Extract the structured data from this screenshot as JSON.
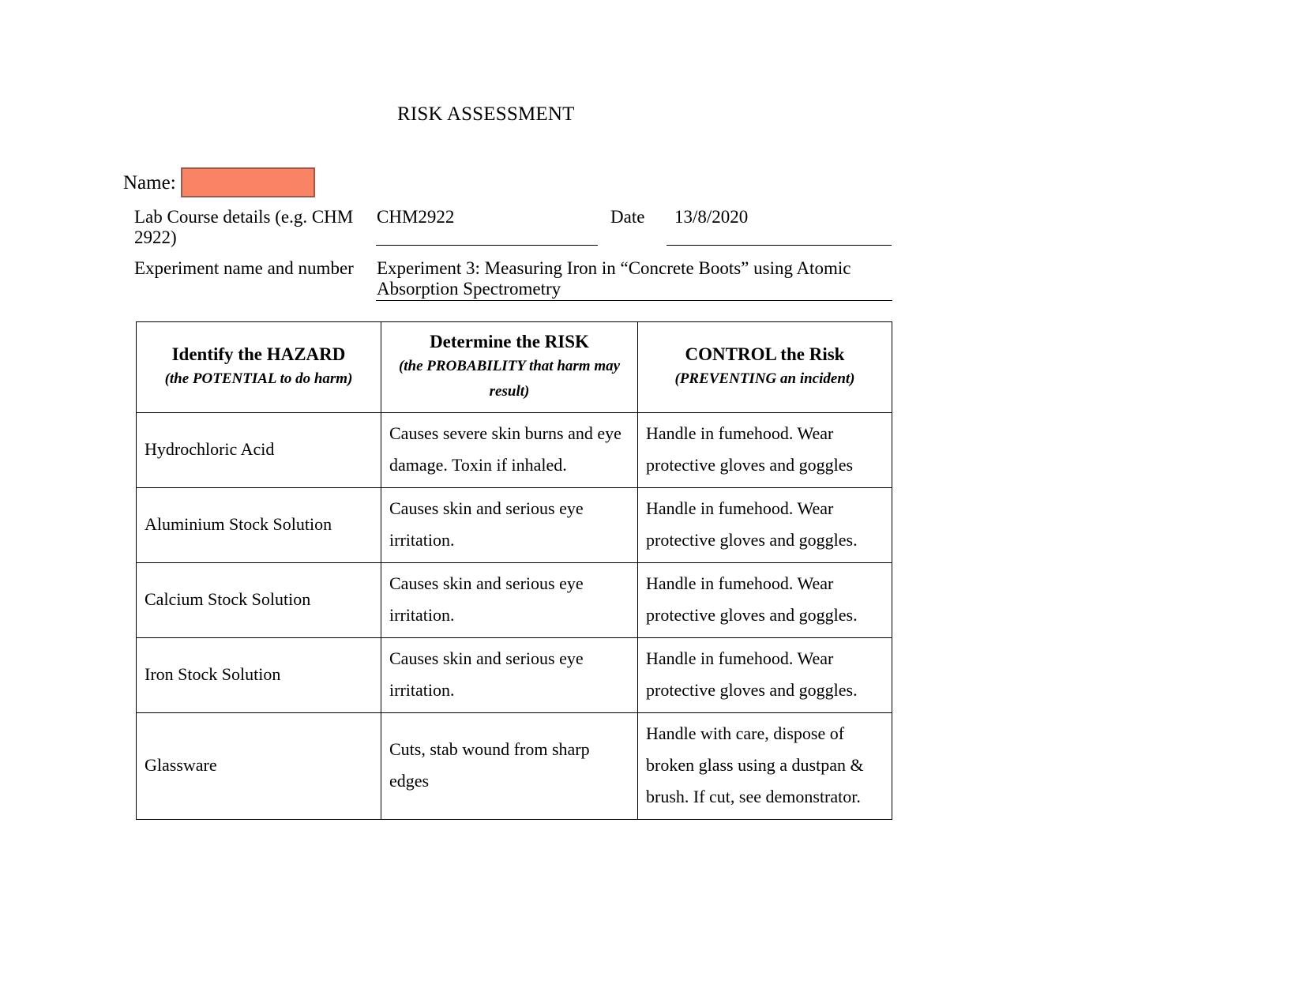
{
  "document": {
    "title": "RISK ASSESSMENT"
  },
  "name_field": {
    "label": "Name:",
    "value": "",
    "redacted": true,
    "redaction_color": "#F98365",
    "redaction_border_color": "#9C5A4A"
  },
  "fields": {
    "lab_course": {
      "label": "Lab Course details (e.g. CHM 2922)",
      "value": "CHM2922"
    },
    "date": {
      "label": "Date",
      "value": "13/8/2020"
    },
    "experiment": {
      "label": "Experiment name and number",
      "value": "Experiment 3: Measuring Iron in “Concrete Boots” using Atomic Absorption Spectrometry"
    }
  },
  "table": {
    "headers": [
      {
        "main": "Identify the HAZARD",
        "sub": "(the POTENTIAL to do harm)"
      },
      {
        "main": "Determine the RISK",
        "sub": "(the PROBABILITY that harm may result)"
      },
      {
        "main": "CONTROL the Risk",
        "sub": "(PREVENTING an incident)"
      }
    ],
    "rows": [
      {
        "hazard": "Hydrochloric Acid",
        "risk": "Causes severe skin burns and eye damage. Toxin if inhaled.",
        "control": "Handle in fumehood. Wear protective gloves and goggles"
      },
      {
        "hazard": "Aluminium Stock Solution",
        "risk": "Causes skin and serious eye irritation.",
        "control": "Handle in fumehood. Wear protective gloves and goggles."
      },
      {
        "hazard": "Calcium Stock Solution",
        "risk": "Causes skin and serious eye irritation.",
        "control": "Handle in fumehood. Wear protective gloves and goggles."
      },
      {
        "hazard": "Iron Stock Solution",
        "risk": "Causes skin and serious eye irritation.",
        "control": "Handle in fumehood. Wear protective gloves and goggles."
      },
      {
        "hazard": "Glassware",
        "risk": "Cuts, stab wound from sharp edges",
        "control": "Handle with care, dispose of broken glass using a dustpan & brush. If cut, see demonstrator."
      }
    ]
  }
}
